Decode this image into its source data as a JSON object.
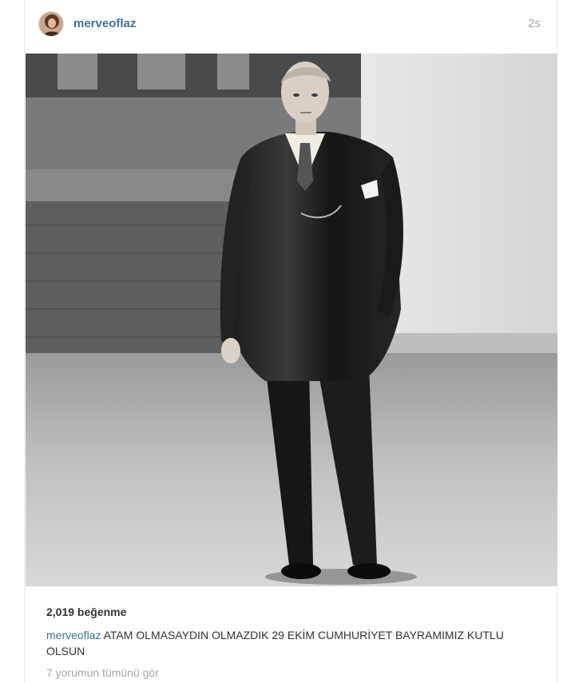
{
  "post": {
    "username": "merveoflaz",
    "timestamp": "2s",
    "avatar_icon": "user-avatar-icon",
    "photo_alt": "photo",
    "likes": "2,019 beğenme",
    "caption_user": "merveoflaz",
    "caption_text": "ATAM OLMASAYDIN OLMAZDIK 29 EKİM CUMHURİYET BAYRAMIMIZ KUTLU OLSUN",
    "view_comments": "7 yorumun tümünü gör"
  },
  "colors": {
    "link": "#3f729b",
    "muted": "#a5a7aa",
    "text": "#333333"
  }
}
